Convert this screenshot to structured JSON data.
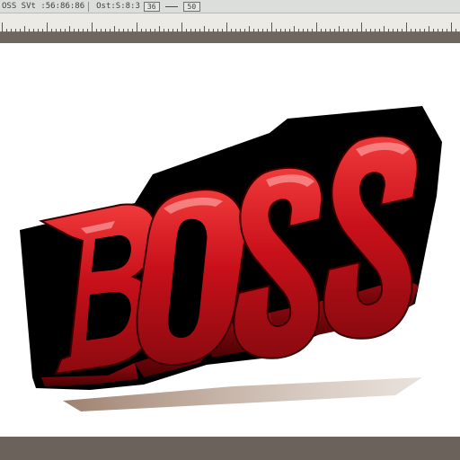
{
  "toolbar": {
    "label_left": "OSS SVt :56:86:86",
    "label_coords": "Ost:S:8:3",
    "value_box": "36",
    "zoom_box": "50"
  },
  "canvas": {
    "artwork_text": "BOSS",
    "colors": {
      "letter_red": "#d0141c",
      "letter_dark_red": "#7a0508",
      "outline": "#000000",
      "shadow": "#b49a86",
      "toolbar_bg": "#dcdedb",
      "ruler_bg": "#eceae4",
      "band": "#6f665f"
    }
  }
}
